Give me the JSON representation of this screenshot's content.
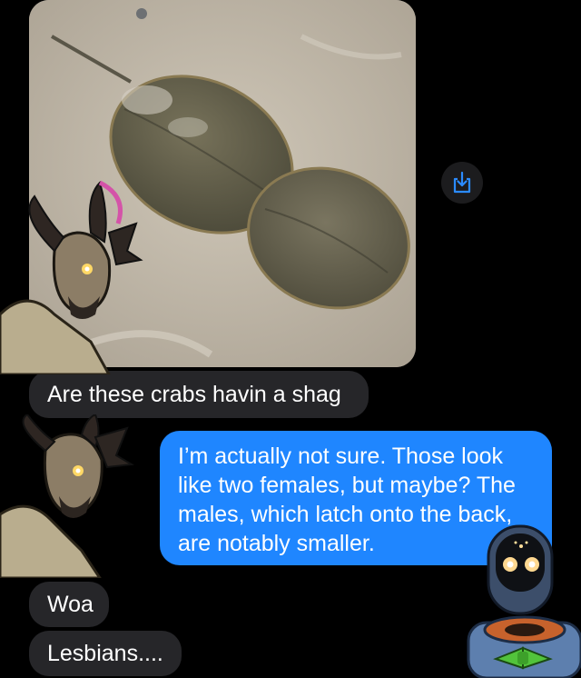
{
  "icons": {
    "save": "square-and-arrow-down-icon",
    "avatar_left": "goat-character-avatar",
    "avatar_right": "robot-character-avatar"
  },
  "colors": {
    "incoming_bubble": "#262629",
    "outgoing_bubble": "#1f86ff",
    "background": "#000000"
  },
  "messages": [
    {
      "sender": "incoming",
      "text": "Are these crabs havin a shag"
    },
    {
      "sender": "outgoing",
      "lines": [
        "I’m actually not sure. Those look",
        "like two females, but maybe? The",
        "males, which latch onto the back,",
        "are notably smaller."
      ]
    },
    {
      "sender": "incoming",
      "text": "Woa"
    },
    {
      "sender": "incoming",
      "text": "Lesbians...."
    }
  ]
}
